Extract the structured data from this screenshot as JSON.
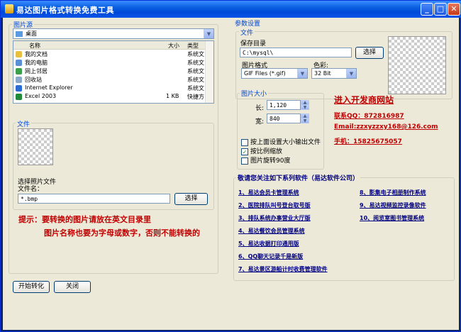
{
  "window": {
    "title": "易达图片格式转换免费工具",
    "minimize": "_",
    "maximize": "□",
    "close": "✕"
  },
  "source": {
    "group_label": "图片源",
    "folder_value": "桌面",
    "columns": [
      "名称",
      "大小",
      "类型"
    ],
    "rows": [
      {
        "name": "我的文档",
        "size": "",
        "type": "系统文",
        "icon_color": "#e8c040"
      },
      {
        "name": "我的电脑",
        "size": "",
        "type": "系统文",
        "icon_color": "#5a8fd8"
      },
      {
        "name": "网上邻居",
        "size": "",
        "type": "系统文",
        "icon_color": "#3aa04a"
      },
      {
        "name": "回收站",
        "size": "",
        "type": "系统文",
        "icon_color": "#8aa8c8"
      },
      {
        "name": "Internet Explorer",
        "size": "",
        "type": "系统文",
        "icon_color": "#2b6cd4"
      },
      {
        "name": "Excel 2003",
        "size": "1 KB",
        "type": "快捷方",
        "icon_color": "#1e8a3a"
      }
    ],
    "file_group_label": "文件",
    "select_label": "选择照片文件",
    "filename_label": "文件名：",
    "filename_value": "*.bmp",
    "choose_button": "选择"
  },
  "hint": {
    "line1": "提示：要转换的图片请放在英文目录里",
    "line2": "图片名称也要为字母或数字，否则不能转换的"
  },
  "buttons": {
    "start": "开始转化",
    "close": "关闭"
  },
  "params": {
    "group_label": "参数设置",
    "file_label": "文件",
    "save_dir_label": "保存目录",
    "save_dir_value": "C:\\mysql\\",
    "choose_button": "选择",
    "format_label": "图片格式",
    "format_value": "GIF Files (*.gif)",
    "color_label": "色彩:",
    "color_value": "32 Bit",
    "size_group_label": "图片大小",
    "length_label": "长:",
    "length_value": "1,120",
    "width_label": "宽:",
    "width_value": "840",
    "opt1": "按上面设置大小输出文件",
    "opt1_checked": false,
    "opt2": "按比例缩放",
    "opt2_checked": true,
    "opt3": "图片旋转90度",
    "opt3_checked": false
  },
  "promo": {
    "title": "进入开发商网站",
    "qq": "联系QQ：872816987",
    "email": "Email:zzxyzzxy168@126.com",
    "phone": "手机：15825675057"
  },
  "software": {
    "header": "敬请您关注如下系列软件（易达软件公司）",
    "items_left": [
      "1、易达会员卡管理系统",
      "2、医院排队叫号登台取号版",
      "3、排队系统办事营业大厅版",
      "4、易达餐饮会员管理系统",
      "5、易达收据打印通用版",
      "6、QQ聊天记录千是新版",
      "7、易达景区游船计时收费管理软件"
    ],
    "items_right": [
      "8、影集电子相册制作系统",
      "9、易达视频监控录像软件",
      "10、阅览室图书管理系统"
    ]
  }
}
